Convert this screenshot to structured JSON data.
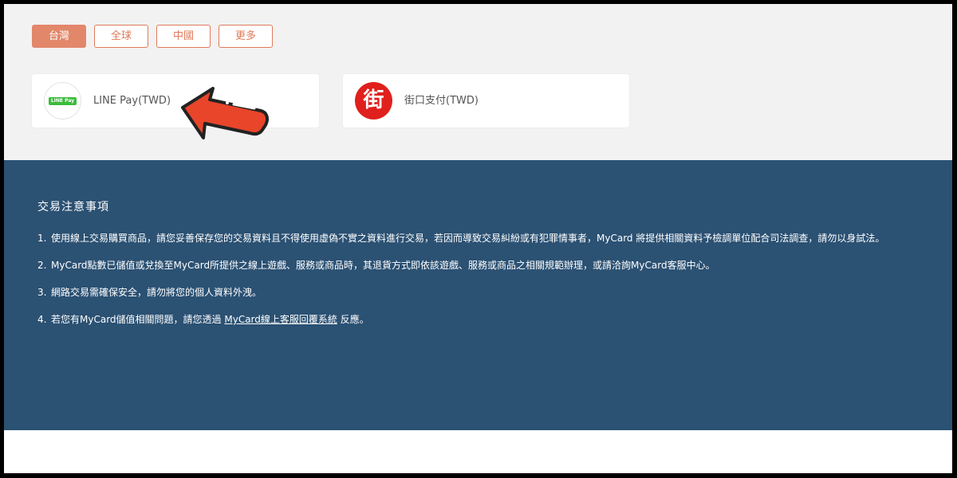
{
  "tabs": [
    {
      "label": "台灣",
      "active": true
    },
    {
      "label": "全球",
      "active": false
    },
    {
      "label": "中國",
      "active": false
    },
    {
      "label": "更多",
      "active": false
    }
  ],
  "payment_methods": [
    {
      "label": "LINE Pay(TWD)",
      "logo_text": "LINE Pay",
      "icon": "line-pay-icon"
    },
    {
      "label": "街口支付(TWD)",
      "logo_text": "街",
      "icon": "jkopay-icon"
    }
  ],
  "notice": {
    "title": "交易注意事項",
    "items": [
      {
        "num": "1.",
        "text": "使用線上交易購買商品，請您妥善保存您的交易資料且不得使用虛偽不實之資料進行交易，若因而導致交易糾紛或有犯罪情事者，MyCard 將提供相關資料予檢調單位配合司法調查，請勿以身試法。"
      },
      {
        "num": "2.",
        "text": "MyCard點數已儲值或兌換至MyCard所提供之線上遊戲、服務或商品時，其退貨方式即依該遊戲、服務或商品之相關規範辦理，或請洽詢MyCard客服中心。"
      },
      {
        "num": "3.",
        "text": "網路交易需確保安全，請勿將您的個人資料外洩。"
      },
      {
        "num": "4.",
        "text_before": "若您有MyCard儲值相關問題，請您透過",
        "link": "MyCard線上客服回覆系統",
        "text_after": "反應。"
      }
    ]
  },
  "colors": {
    "accent": "#e2876a",
    "notice_bg": "#2b5173",
    "arrow": "#e8452a"
  }
}
